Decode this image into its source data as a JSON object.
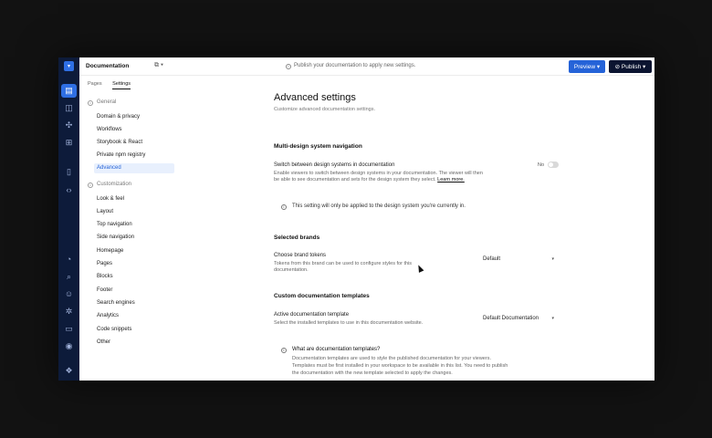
{
  "topbar": {
    "doc_title": "Documentation",
    "doc_ctrl": "⧉ ▾",
    "notice": "Publish your documentation to apply new settings.",
    "preview_label": "Preview ▾",
    "publish_label": "⊘ Publish ▾"
  },
  "sidebar": {
    "tabs": [
      "Pages",
      "Settings"
    ],
    "sections": [
      {
        "title": "General",
        "items": [
          "Domain & privacy",
          "Workflows",
          "Storybook & React",
          "Private npm registry",
          "Advanced"
        ]
      },
      {
        "title": "Customization",
        "items": [
          "Look & feel",
          "Layout",
          "Top navigation",
          "Side navigation",
          "Homepage",
          "Pages",
          "Blocks",
          "Footer",
          "Search engines",
          "Analytics",
          "Code snippets",
          "Other"
        ]
      }
    ],
    "active_item": "Advanced"
  },
  "main": {
    "title": "Advanced settings",
    "subtitle": "Customize advanced documentation settings.",
    "multi": {
      "heading": "Multi-design system navigation",
      "label": "Switch between design systems in documentation",
      "desc1": "Enable viewers to switch between design systems in your documentation. The viewer will then",
      "desc2": "be able to see documentation and sets for the design system they select.",
      "link": "Learn more.",
      "toggle_label": "No",
      "info": "This setting will only be applied to the design system you're currently in."
    },
    "brands": {
      "heading": "Selected brands",
      "label": "Choose brand tokens",
      "desc1": "Tokens from this brand can be used to configure styles for this",
      "desc2": "documentation.",
      "select": "Default"
    },
    "templates": {
      "heading": "Custom documentation templates",
      "label": "Active documentation template",
      "desc": "Select the installed templates to use in this documentation website.",
      "select": "Default Documentation",
      "callout_title": "What are documentation templates?",
      "callout_1": "Documentation templates are used to style the published documentation for your viewers.",
      "callout_2": "Templates must be first installed in your workspace to be available in this list. You need to publish",
      "callout_3": "the documentation with the new template selected to apply the changes."
    }
  },
  "colors": {
    "accent": "#2563d8",
    "rail": "#0d1b3a",
    "active_bg": "#e8f0fd"
  }
}
